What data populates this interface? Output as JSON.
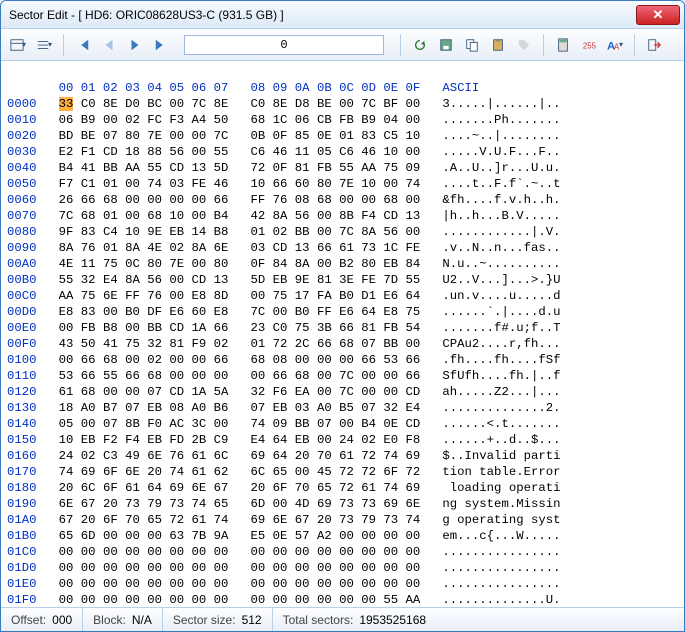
{
  "title": "Sector Edit - [ HD6: ORIC08628US3-C (931.5 GB) ]",
  "offset_input": "0",
  "columns_left": [
    "00",
    "01",
    "02",
    "03",
    "04",
    "05",
    "06",
    "07"
  ],
  "columns_right": [
    "08",
    "09",
    "0A",
    "0B",
    "0C",
    "0D",
    "0E",
    "0F"
  ],
  "ascii_header": "ASCII",
  "rows": [
    {
      "addr": "0000",
      "l": "33 C0 8E D0 BC 00 7C 8E",
      "r": "C0 8E D8 BE 00 7C BF 00",
      "a": "3.....|......|.."
    },
    {
      "addr": "0010",
      "l": "06 B9 00 02 FC F3 A4 50",
      "r": "68 1C 06 CB FB B9 04 00",
      "a": ".......Ph......."
    },
    {
      "addr": "0020",
      "l": "BD BE 07 80 7E 00 00 7C",
      "r": "0B 0F 85 0E 01 83 C5 10",
      "a": "....~..|........"
    },
    {
      "addr": "0030",
      "l": "E2 F1 CD 18 88 56 00 55",
      "r": "C6 46 11 05 C6 46 10 00",
      "a": ".....V.U.F...F.."
    },
    {
      "addr": "0040",
      "l": "B4 41 BB AA 55 CD 13 5D",
      "r": "72 0F 81 FB 55 AA 75 09",
      "a": ".A..U..]r...U.u."
    },
    {
      "addr": "0050",
      "l": "F7 C1 01 00 74 03 FE 46",
      "r": "10 66 60 80 7E 10 00 74",
      "a": "....t..F.f`.~..t"
    },
    {
      "addr": "0060",
      "l": "26 66 68 00 00 00 00 66",
      "r": "FF 76 08 68 00 00 68 00",
      "a": "&fh....f.v.h..h."
    },
    {
      "addr": "0070",
      "l": "7C 68 01 00 68 10 00 B4",
      "r": "42 8A 56 00 8B F4 CD 13",
      "a": "|h..h...B.V....."
    },
    {
      "addr": "0080",
      "l": "9F 83 C4 10 9E EB 14 B8",
      "r": "01 02 BB 00 7C 8A 56 00",
      "a": "............|.V."
    },
    {
      "addr": "0090",
      "l": "8A 76 01 8A 4E 02 8A 6E",
      "r": "03 CD 13 66 61 73 1C FE",
      "a": ".v..N..n...fas.."
    },
    {
      "addr": "00A0",
      "l": "4E 11 75 0C 80 7E 00 80",
      "r": "0F 84 8A 00 B2 80 EB 84",
      "a": "N.u..~.........."
    },
    {
      "addr": "00B0",
      "l": "55 32 E4 8A 56 00 CD 13",
      "r": "5D EB 9E 81 3E FE 7D 55",
      "a": "U2..V...]...>.}U"
    },
    {
      "addr": "00C0",
      "l": "AA 75 6E FF 76 00 E8 8D",
      "r": "00 75 17 FA B0 D1 E6 64",
      "a": ".un.v....u.....d"
    },
    {
      "addr": "00D0",
      "l": "E8 83 00 B0 DF E6 60 E8",
      "r": "7C 00 B0 FF E6 64 E8 75",
      "a": "......`.|....d.u"
    },
    {
      "addr": "00E0",
      "l": "00 FB B8 00 BB CD 1A 66",
      "r": "23 C0 75 3B 66 81 FB 54",
      "a": ".......f#.u;f..T"
    },
    {
      "addr": "00F0",
      "l": "43 50 41 75 32 81 F9 02",
      "r": "01 72 2C 66 68 07 BB 00",
      "a": "CPAu2....r,fh..."
    },
    {
      "addr": "0100",
      "l": "00 66 68 00 02 00 00 66",
      "r": "68 08 00 00 00 66 53 66",
      "a": ".fh....fh....fSf"
    },
    {
      "addr": "0110",
      "l": "53 66 55 66 68 00 00 00",
      "r": "00 66 68 00 7C 00 00 66",
      "a": "SfUfh....fh.|..f"
    },
    {
      "addr": "0120",
      "l": "61 68 00 00 07 CD 1A 5A",
      "r": "32 F6 EA 00 7C 00 00 CD",
      "a": "ah.....Z2...|..."
    },
    {
      "addr": "0130",
      "l": "18 A0 B7 07 EB 08 A0 B6",
      "r": "07 EB 03 A0 B5 07 32 E4",
      "a": "..............2."
    },
    {
      "addr": "0140",
      "l": "05 00 07 8B F0 AC 3C 00",
      "r": "74 09 BB 07 00 B4 0E CD",
      "a": "......<.t......."
    },
    {
      "addr": "0150",
      "l": "10 EB F2 F4 EB FD 2B C9",
      "r": "E4 64 EB 00 24 02 E0 F8",
      "a": "......+..d..$..."
    },
    {
      "addr": "0160",
      "l": "24 02 C3 49 6E 76 61 6C",
      "r": "69 64 20 70 61 72 74 69",
      "a": "$..Invalid parti"
    },
    {
      "addr": "0170",
      "l": "74 69 6F 6E 20 74 61 62",
      "r": "6C 65 00 45 72 72 6F 72",
      "a": "tion table.Error"
    },
    {
      "addr": "0180",
      "l": "20 6C 6F 61 64 69 6E 67",
      "r": "20 6F 70 65 72 61 74 69",
      "a": " loading operati"
    },
    {
      "addr": "0190",
      "l": "6E 67 20 73 79 73 74 65",
      "r": "6D 00 4D 69 73 73 69 6E",
      "a": "ng system.Missin"
    },
    {
      "addr": "01A0",
      "l": "67 20 6F 70 65 72 61 74",
      "r": "69 6E 67 20 73 79 73 74",
      "a": "g operating syst"
    },
    {
      "addr": "01B0",
      "l": "65 6D 00 00 00 63 7B 9A",
      "r": "E5 0E 57 A2 00 00 00 00",
      "a": "em...c{...W....."
    },
    {
      "addr": "01C0",
      "l": "00 00 00 00 00 00 00 00",
      "r": "00 00 00 00 00 00 00 00",
      "a": "................"
    },
    {
      "addr": "01D0",
      "l": "00 00 00 00 00 00 00 00",
      "r": "00 00 00 00 00 00 00 00",
      "a": "................"
    },
    {
      "addr": "01E0",
      "l": "00 00 00 00 00 00 00 00",
      "r": "00 00 00 00 00 00 00 00",
      "a": "................"
    },
    {
      "addr": "01F0",
      "l": "00 00 00 00 00 00 00 00",
      "r": "00 00 00 00 00 00 55 AA",
      "a": "..............U."
    }
  ],
  "status": {
    "offset_label": "Offset:",
    "offset_value": "000",
    "block_label": "Block:",
    "block_value": "N/A",
    "sector_size_label": "Sector size:",
    "sector_size_value": "512",
    "total_sectors_label": "Total sectors:",
    "total_sectors_value": "1953525168"
  }
}
